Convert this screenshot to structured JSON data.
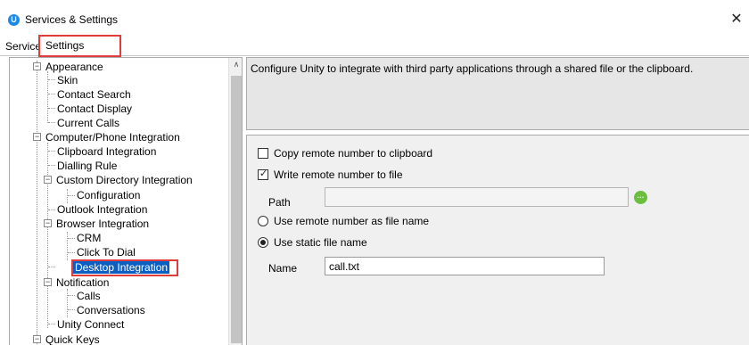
{
  "window": {
    "title": "Services & Settings",
    "app_icon_letter": "U",
    "close_glyph": "✕"
  },
  "tabs": [
    {
      "label": "Services",
      "active": false
    },
    {
      "label": "Settings",
      "active": true
    }
  ],
  "tree": {
    "items": [
      {
        "label": "Appearance",
        "expander": "−"
      },
      {
        "label": "Skin"
      },
      {
        "label": "Contact Search"
      },
      {
        "label": "Contact Display"
      },
      {
        "label": "Current Calls"
      },
      {
        "label": "Computer/Phone Integration",
        "expander": "−"
      },
      {
        "label": "Clipboard Integration"
      },
      {
        "label": "Dialling Rule"
      },
      {
        "label": "Custom Directory Integration",
        "expander": "−"
      },
      {
        "label": "Configuration"
      },
      {
        "label": "Outlook Integration"
      },
      {
        "label": "Browser Integration",
        "expander": "−"
      },
      {
        "label": "CRM"
      },
      {
        "label": "Click To Dial"
      },
      {
        "label": "Desktop Integration",
        "selected": true
      },
      {
        "label": "Notification",
        "expander": "−"
      },
      {
        "label": "Calls"
      },
      {
        "label": "Conversations"
      },
      {
        "label": "Unity Connect"
      },
      {
        "label": "Quick Keys",
        "expander": "−"
      }
    ],
    "scroll_up_glyph": "∧"
  },
  "description": "Configure Unity to integrate with third party applications through a shared file or the clipboard.",
  "settings": {
    "copy_to_clipboard": {
      "label": "Copy remote number to clipboard",
      "checked": false
    },
    "write_to_file": {
      "label": "Write remote number to file",
      "checked": true
    },
    "path_label": "Path",
    "path_value": "",
    "browse_icon": "folder-browse-icon",
    "use_remote_name": {
      "label": "Use remote number as file name",
      "selected": false
    },
    "use_static_name": {
      "label": "Use static file name",
      "selected": true
    },
    "name_label": "Name",
    "name_value": "call.txt"
  },
  "colors": {
    "highlight_red": "#e23b3b",
    "selection_blue": "#0b5fc2",
    "panel_gray": "#f0f0f0"
  }
}
